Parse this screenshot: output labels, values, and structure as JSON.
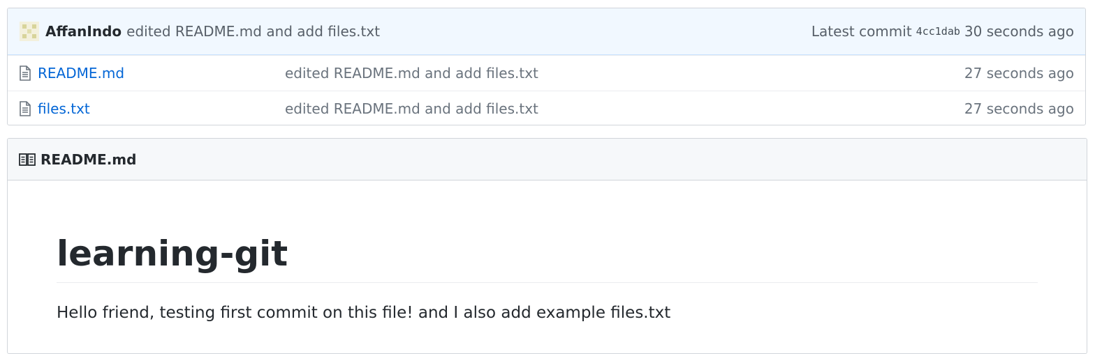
{
  "latest_commit": {
    "author": "AffanIndo",
    "message": "edited README.md and add files.txt",
    "label": "Latest commit",
    "sha": "4cc1dab",
    "age": "30 seconds ago"
  },
  "files": [
    {
      "name": "README.md",
      "commit": "edited README.md and add files.txt",
      "age": "27 seconds ago",
      "icon": "file-icon"
    },
    {
      "name": "files.txt",
      "commit": "edited README.md and add files.txt",
      "age": "27 seconds ago",
      "icon": "file-icon"
    }
  ],
  "readme": {
    "header_icon": "book-icon",
    "filename": "README.md",
    "title": "learning-git",
    "body": "Hello friend, testing first commit on this file! and I also add example files.txt"
  }
}
